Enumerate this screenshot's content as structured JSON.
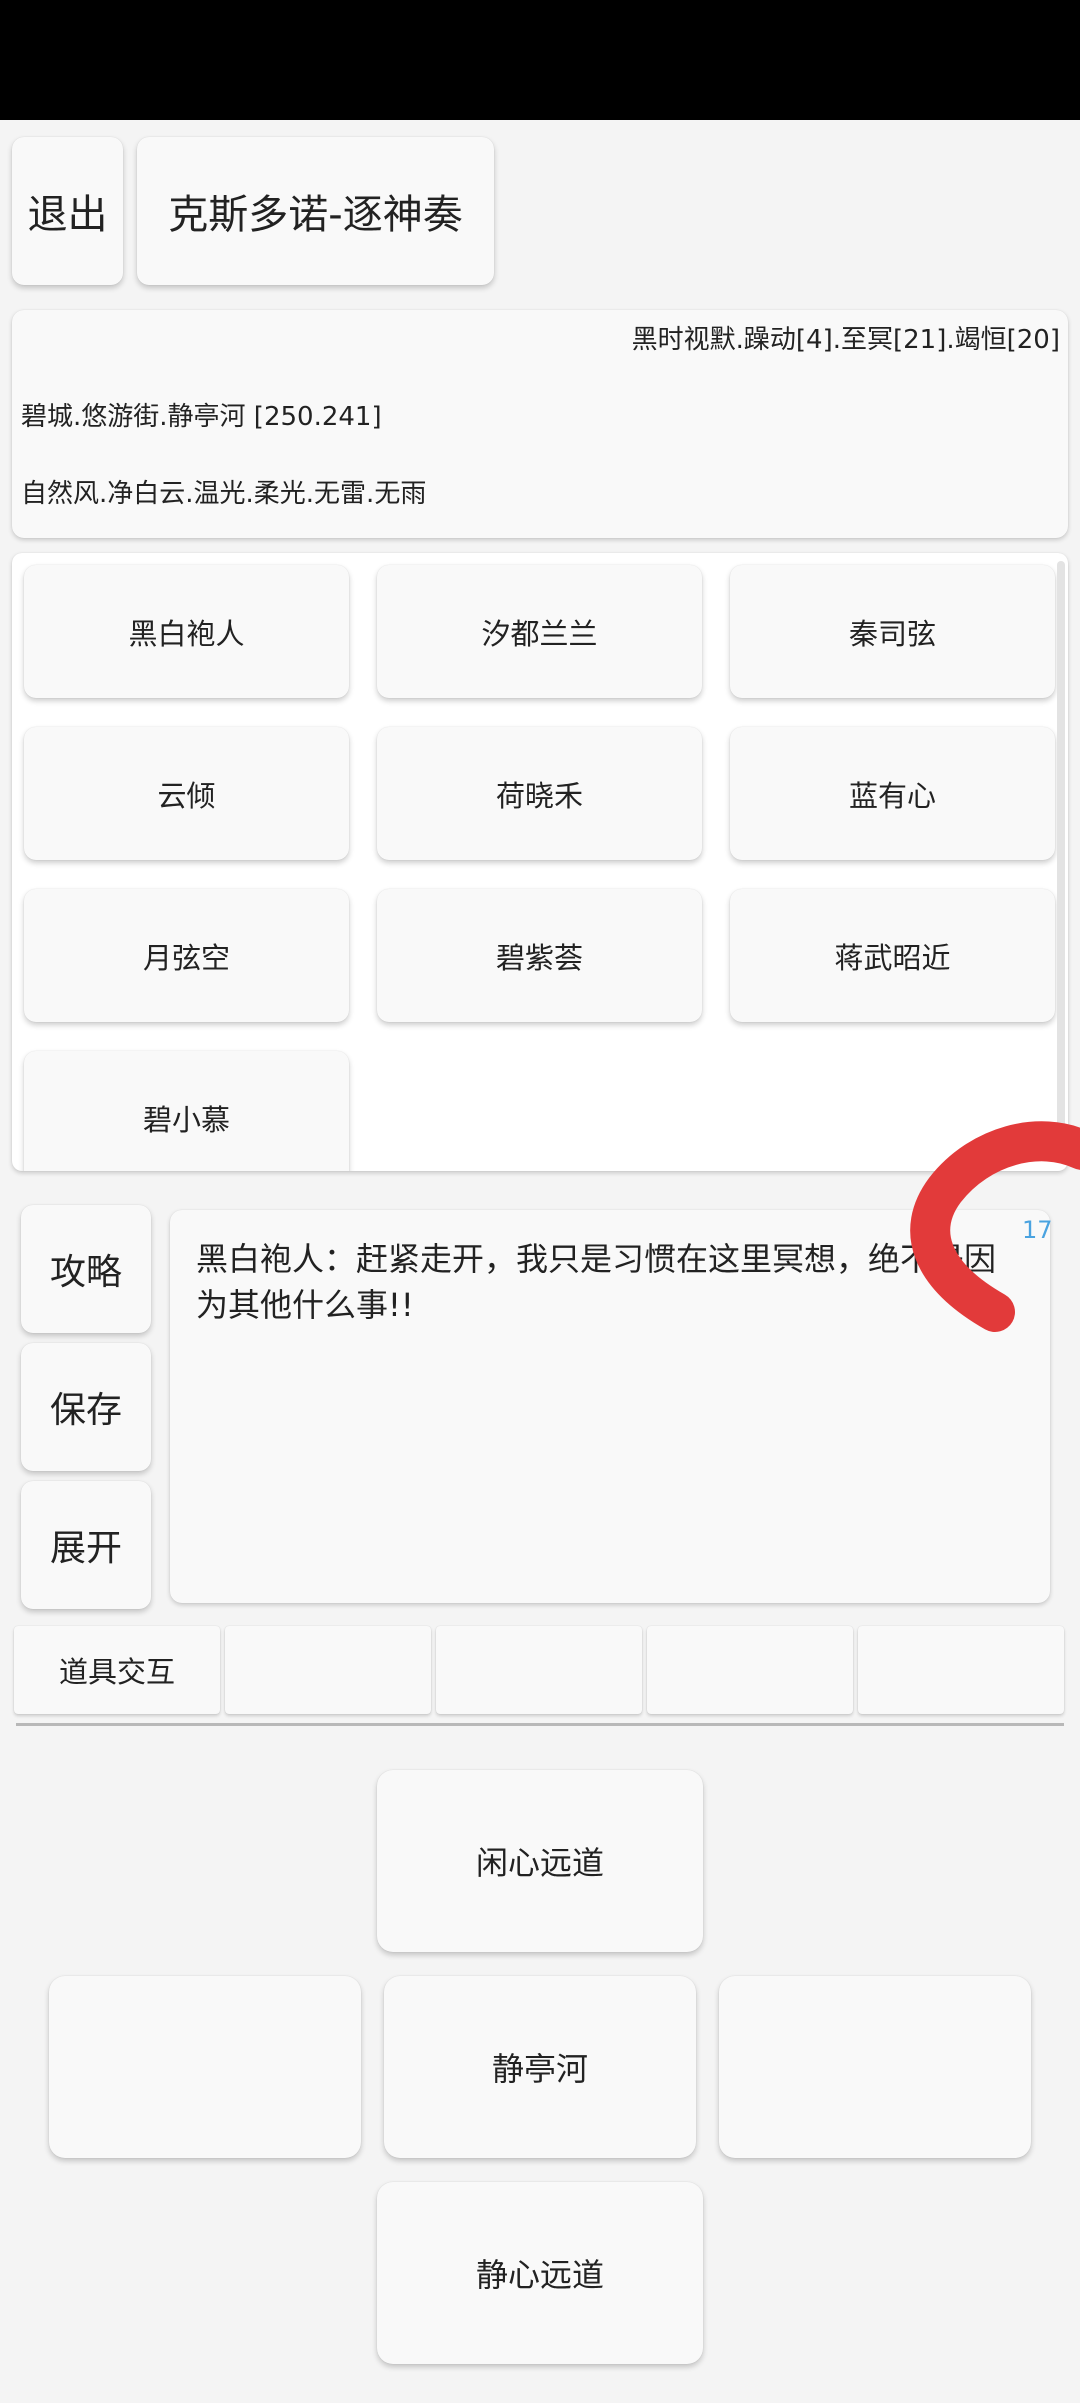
{
  "header": {
    "exit_label": "退出",
    "title_label": "克斯多诺-逐神奏"
  },
  "info": {
    "time": "黑时视默.躁动[4].至冥[21].竭恒[20]",
    "location": "碧城.悠游街.静亭河 [250.241]",
    "weather": "自然风.净白云.温光.柔光.无雷.无雨"
  },
  "npcs": [
    "黑白袍人",
    "汐都兰兰",
    "秦司弦",
    "云倾",
    "荷晓禾",
    "蓝有心",
    "月弦空",
    "碧紫荟",
    "蒋武昭近",
    "碧小慕"
  ],
  "actions": {
    "guide_label": "攻略",
    "save_label": "保存",
    "expand_label": "展开"
  },
  "dialog": {
    "text": "黑白袍人：赶紧走开，我只是习惯在这里冥想，绝不是因为其他什么事!!",
    "count": "17"
  },
  "items": {
    "slots": [
      "道具交互",
      "",
      "",
      "",
      ""
    ]
  },
  "nav": {
    "north": "闲心远道",
    "west": "",
    "center": "静亭河",
    "east": "",
    "south": "静心远道"
  },
  "colors": {
    "status_bar": "#000000",
    "background": "#f4f4f4",
    "button": "#f9f9f9",
    "counter": "#4aa3e0",
    "annotation_stroke": "#e23a3a"
  }
}
